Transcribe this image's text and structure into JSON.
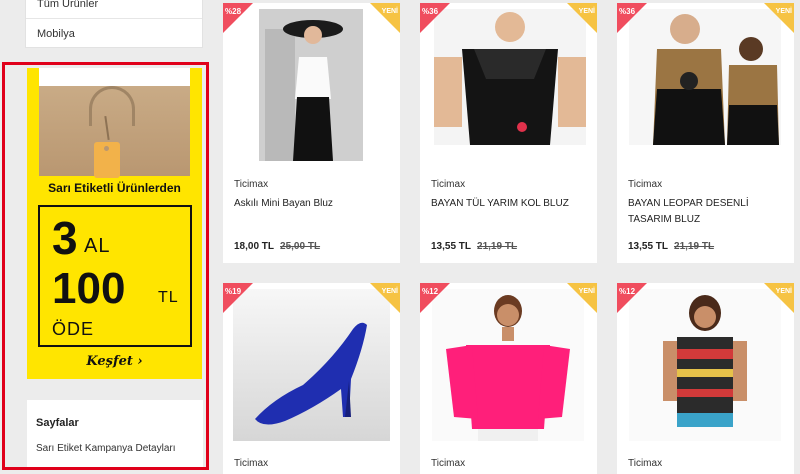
{
  "sidebar": {
    "categories": [
      "Tüm Ürünler",
      "Mobilya"
    ],
    "banner": {
      "subtitle": "Sarı Etiketli Ürünlerden",
      "num1": "3",
      "al": "AL",
      "num2": "100",
      "tl": "TL",
      "ode": "ÖDE",
      "cta": "Keşfet ›"
    },
    "pages": {
      "title": "Sayfalar",
      "link": "Sarı Etiket Kampanya Detayları"
    }
  },
  "products": [
    {
      "discount": "%28",
      "new": "YENİ",
      "brand": "Ticimax",
      "name": "Askılı Mini Bayan Bluz",
      "price": "18,00 TL",
      "old_price": "25,00 TL"
    },
    {
      "discount": "%36",
      "new": "YENİ",
      "brand": "Ticimax",
      "name": "BAYAN TÜL YARIM KOL BLUZ",
      "price": "13,55 TL",
      "old_price": "21,19 TL"
    },
    {
      "discount": "%36",
      "new": "YENİ",
      "brand": "Ticimax",
      "name": "BAYAN LEOPAR DESENLİ TASARIM BLUZ",
      "price": "13,55 TL",
      "old_price": "21,19 TL"
    },
    {
      "discount": "%19",
      "new": "YENİ",
      "brand": "Ticimax",
      "name": "",
      "price": "",
      "old_price": ""
    },
    {
      "discount": "%12",
      "new": "YENİ",
      "brand": "Ticimax",
      "name": "",
      "price": "",
      "old_price": ""
    },
    {
      "discount": "%12",
      "new": "YENİ",
      "brand": "Ticimax",
      "name": "",
      "price": "",
      "old_price": ""
    }
  ],
  "colors": {
    "highlight": "#e0001a",
    "banner": "#ffe500",
    "discount": "#f04d5e",
    "new": "#f6c343"
  }
}
